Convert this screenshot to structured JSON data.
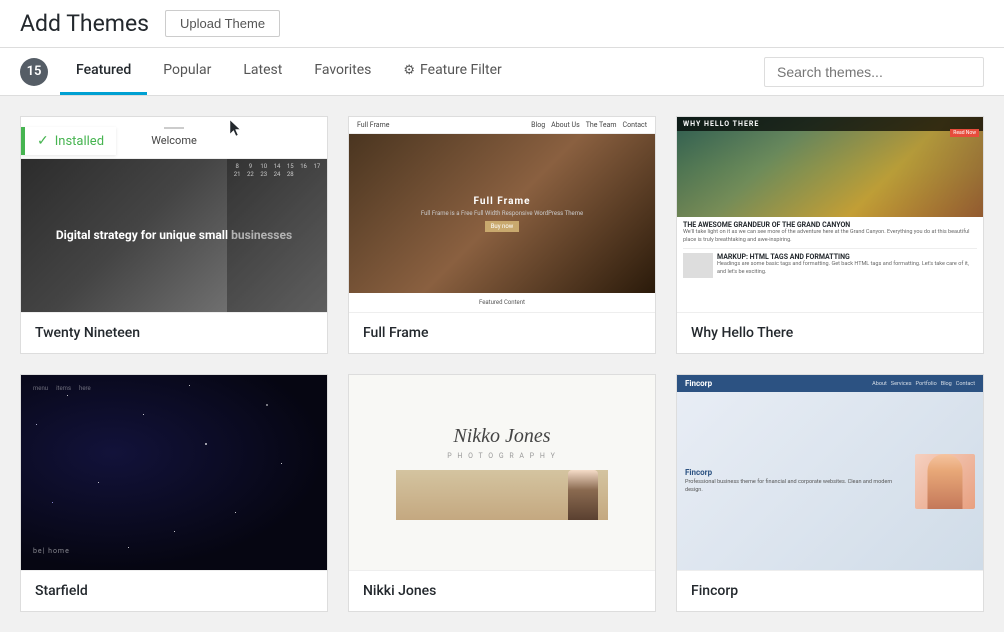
{
  "header": {
    "title": "Add Themes",
    "upload_btn": "Upload Theme"
  },
  "tabs": {
    "count": "15",
    "items": [
      {
        "id": "featured",
        "label": "Featured",
        "active": true
      },
      {
        "id": "popular",
        "label": "Popular",
        "active": false
      },
      {
        "id": "latest",
        "label": "Latest",
        "active": false
      },
      {
        "id": "favorites",
        "label": "Favorites",
        "active": false
      },
      {
        "id": "feature-filter",
        "label": "Feature Filter",
        "active": false
      }
    ]
  },
  "search": {
    "placeholder": "Search themes..."
  },
  "themes": [
    {
      "id": "twenty-nineteen",
      "name": "Twenty Nineteen",
      "installed": true,
      "installed_label": "Installed"
    },
    {
      "id": "full-frame",
      "name": "Full Frame",
      "installed": false
    },
    {
      "id": "why-hello-there",
      "name": "Why Hello There",
      "installed": false
    },
    {
      "id": "starfield",
      "name": "Starfield",
      "installed": false
    },
    {
      "id": "nikki-jones",
      "name": "Nikki Jones",
      "installed": false
    },
    {
      "id": "fincorp",
      "name": "Fincorp",
      "installed": false
    }
  ],
  "twenty_nineteen": {
    "welcome": "Welcome",
    "hero_text": "Digital strategy for unique small businesses"
  },
  "full_frame": {
    "title": "Full Frame",
    "description": "Full Frame is a Free Full Width Responsive WordPress Theme",
    "featured_label": "Featured Content",
    "nav_items": [
      "Blog",
      "About Us",
      "The Team",
      "Contact"
    ]
  },
  "why_hello_there": {
    "header_text": "WHY HELLO THERE",
    "badge_text": "Read Now",
    "article1_title": "THE AWESOME GRANDEUR OF THE GRAND CANYON",
    "article1_text": "We'll take light on it as we can see more of the adventure here at the Grand Canyon. Everything you do at this beautiful place is truly breathtaking and awe-inspiring.",
    "article2_title": "MARKUP: HTML TAGS AND FORMATTING",
    "article2_text": "Headings are some basic tags and formatting. Get back HTML tags and formatting. Let's take care of it, and let's be exciting."
  }
}
